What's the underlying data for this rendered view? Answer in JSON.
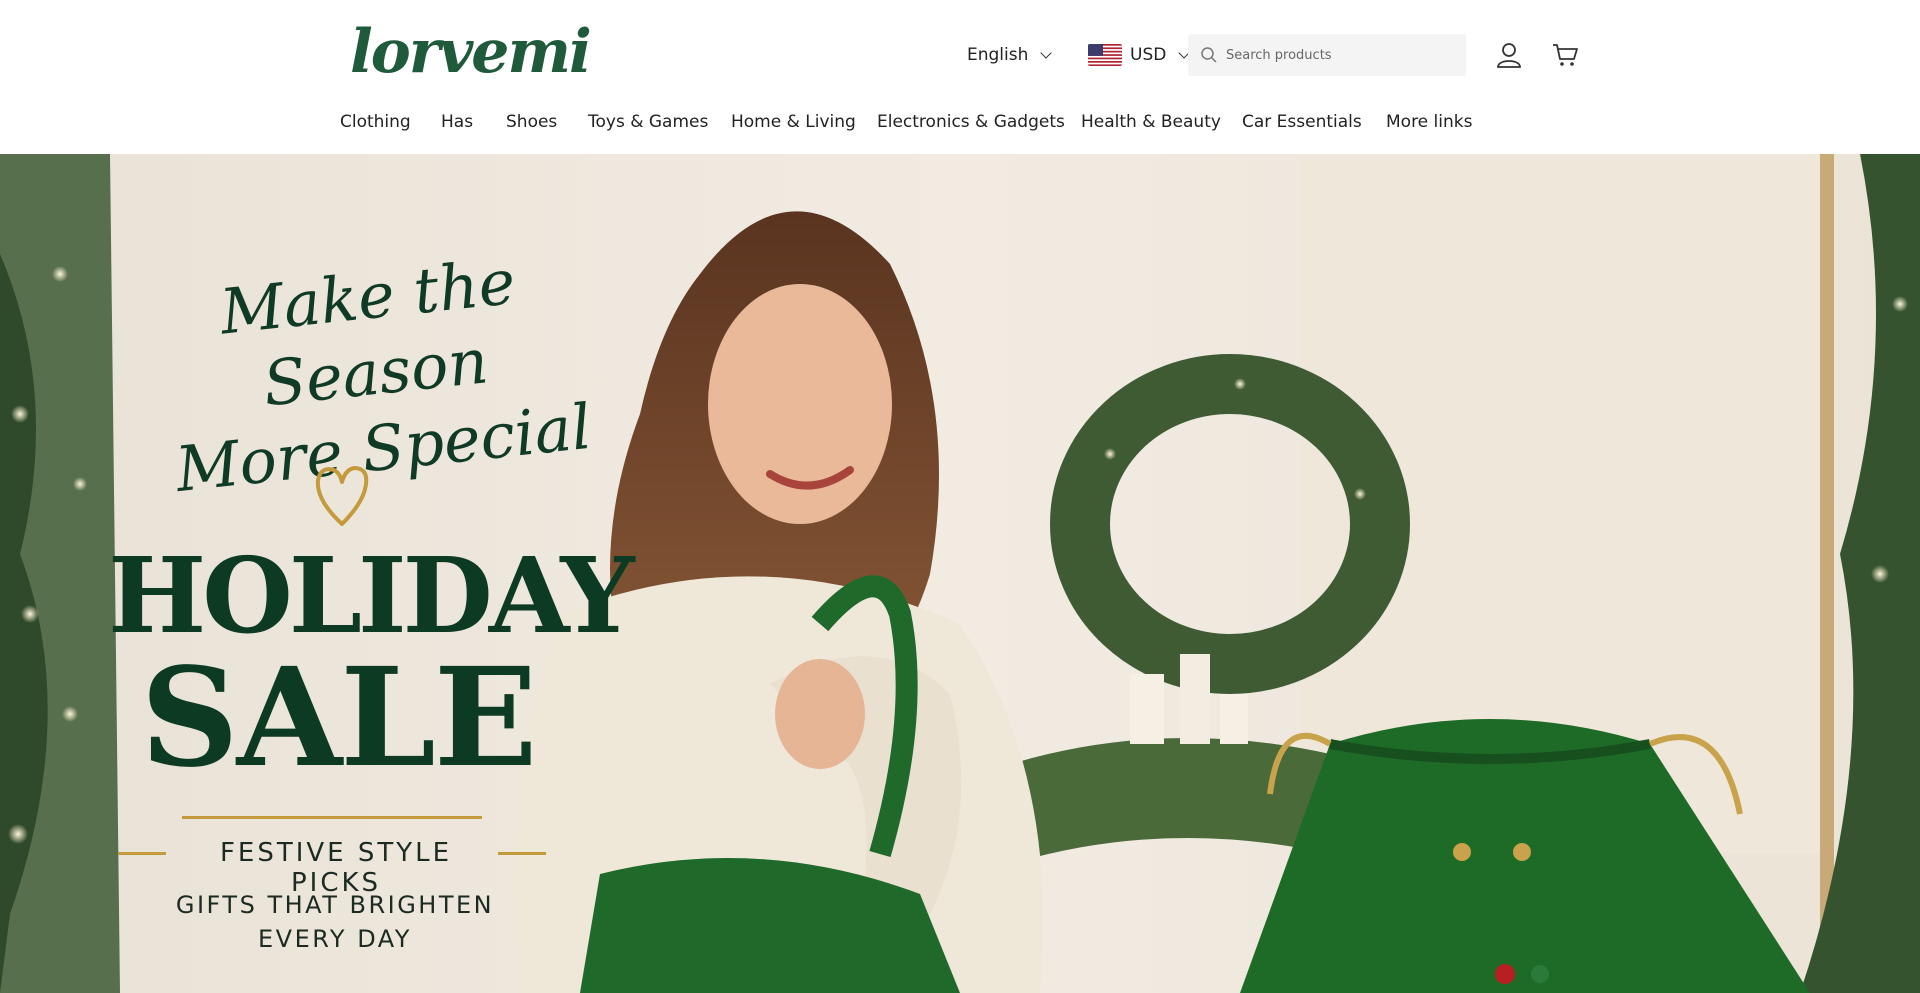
{
  "header": {
    "logo_text": "lorvemi",
    "language": "English",
    "currency": "USD",
    "search": {
      "placeholder": "Search products"
    }
  },
  "nav": {
    "items": [
      {
        "label": "Clothing"
      },
      {
        "label": "Has"
      },
      {
        "label": "Shoes"
      },
      {
        "label": "Toys & Games"
      },
      {
        "label": "Home & Living"
      },
      {
        "label": "Electronics & Gadgets"
      },
      {
        "label": "Health & Beauty"
      },
      {
        "label": "Car Essentials"
      },
      {
        "label": "More links"
      }
    ]
  },
  "hero": {
    "script_line_1": "Make the Season",
    "script_line_2": "More Special",
    "title_1": "HOLIDAY",
    "title_2": "SALE",
    "tagline": "FESTIVE STYLE PICKS",
    "subline_1": "GIFTS THAT BRIGHTEN",
    "subline_2": "EVERY DAY"
  },
  "icons": {
    "account": "user-icon",
    "cart": "cart-icon",
    "search": "search-icon",
    "language_dropdown": "chevron-down-icon",
    "currency_flag": "us-flag-icon"
  },
  "colors": {
    "brand_green": "#1f5a3a",
    "headline_green": "#0c3a22",
    "gold": "#c49a3c"
  }
}
